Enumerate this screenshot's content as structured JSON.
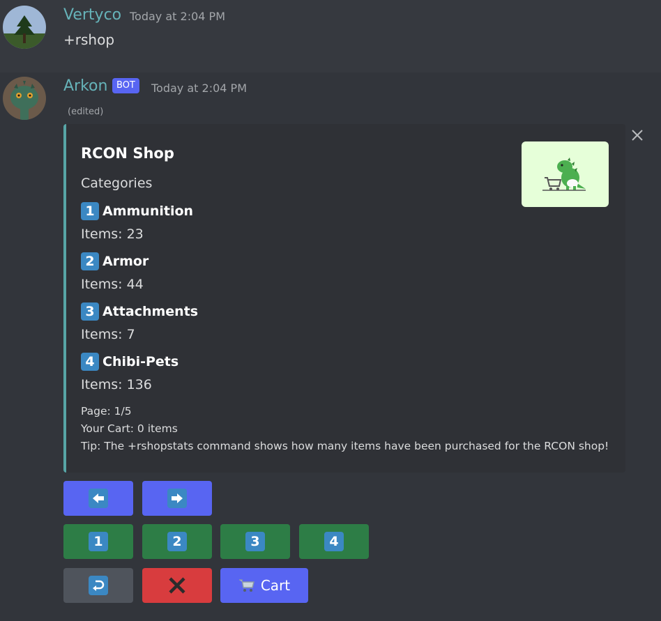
{
  "messages": {
    "user": {
      "username": "Vertyco",
      "timestamp": "Today at 2:04 PM",
      "content": "+rshop"
    },
    "bot": {
      "username": "Arkon",
      "tag": "BOT",
      "timestamp": "Today at 2:04 PM",
      "edited": "(edited)"
    }
  },
  "embed": {
    "accent_color": "#57a5a6",
    "title": "RCON Shop",
    "subtitle": "Categories",
    "categories": [
      {
        "number": "1",
        "name": "Ammunition",
        "items": "Items: 23"
      },
      {
        "number": "2",
        "name": "Armor",
        "items": "Items: 44"
      },
      {
        "number": "3",
        "name": "Attachments",
        "items": "Items: 7"
      },
      {
        "number": "4",
        "name": "Chibi-Pets",
        "items": "Items: 136"
      }
    ],
    "footer": {
      "page": "Page: 1/5",
      "cart": "Your Cart: 0 items",
      "tip": "Tip: The +rshopstats command shows how many items have been purchased for the RCON shop!"
    },
    "thumbnail_icon": "dinosaur-shopping-cart-icon"
  },
  "buttons": {
    "nav": [
      {
        "icon": "arrow-left-icon"
      },
      {
        "icon": "arrow-right-icon"
      }
    ],
    "select": [
      "1",
      "2",
      "3",
      "4"
    ],
    "back_icon": "return-arrow-icon",
    "close_icon": "x-icon",
    "cart_label": "Cart",
    "cart_icon": "shopping-cart-icon"
  },
  "colors": {
    "blurple": "#5865f2",
    "green": "#2d7d46",
    "red": "#d83c3e",
    "grey": "#4f545c",
    "key_blue": "#3b88c3"
  }
}
